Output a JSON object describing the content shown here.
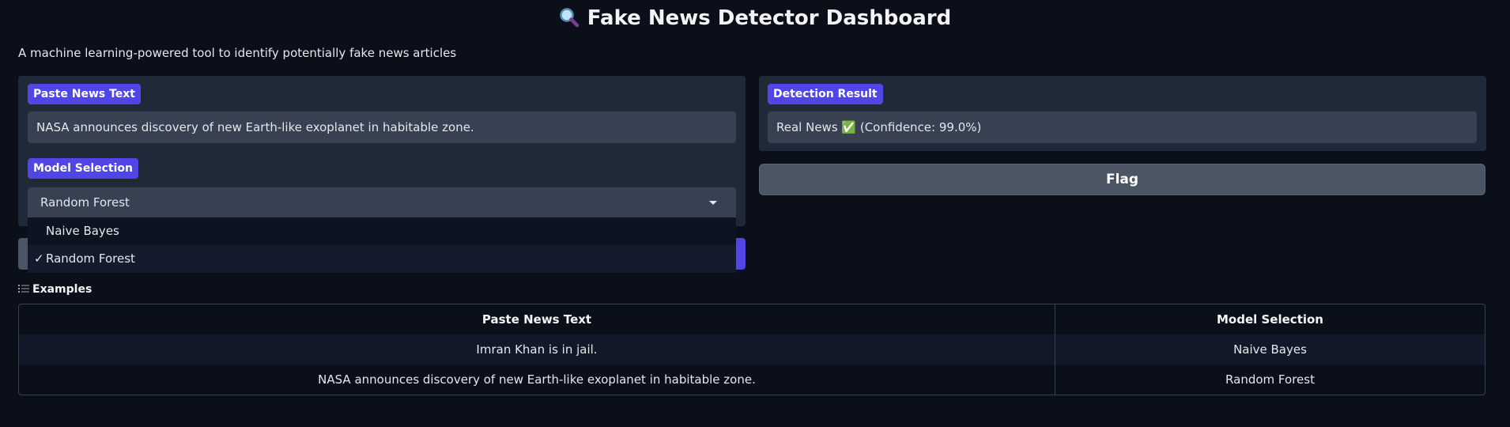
{
  "header": {
    "icon": "magnifying-glass-icon",
    "title": "Fake News Detector Dashboard",
    "subtitle": "A machine learning-powered tool to identify potentially fake news articles"
  },
  "input_panel": {
    "text_label": "Paste News Text",
    "text_value": "NASA announces discovery of new Earth-like exoplanet in habitable zone.",
    "model_label": "Model Selection",
    "model_value": "Random Forest",
    "model_options": [
      {
        "label": "Naive Bayes",
        "selected": false
      },
      {
        "label": "Random Forest",
        "selected": true
      }
    ]
  },
  "output_panel": {
    "result_label": "Detection Result",
    "result_value": "Real News ✅ (Confidence: 99.0%)",
    "flag_label": "Flag"
  },
  "examples": {
    "label": "Examples",
    "headers": [
      "Paste News Text",
      "Model Selection"
    ],
    "rows": [
      [
        "Imran Khan is in jail.",
        "Naive Bayes"
      ],
      [
        "NASA announces discovery of new Earth-like exoplanet in habitable zone.",
        "Random Forest"
      ]
    ]
  },
  "colors": {
    "background": "#0b0f19",
    "panel": "#1f2937",
    "accent": "#4f46e5",
    "field": "#374151"
  }
}
